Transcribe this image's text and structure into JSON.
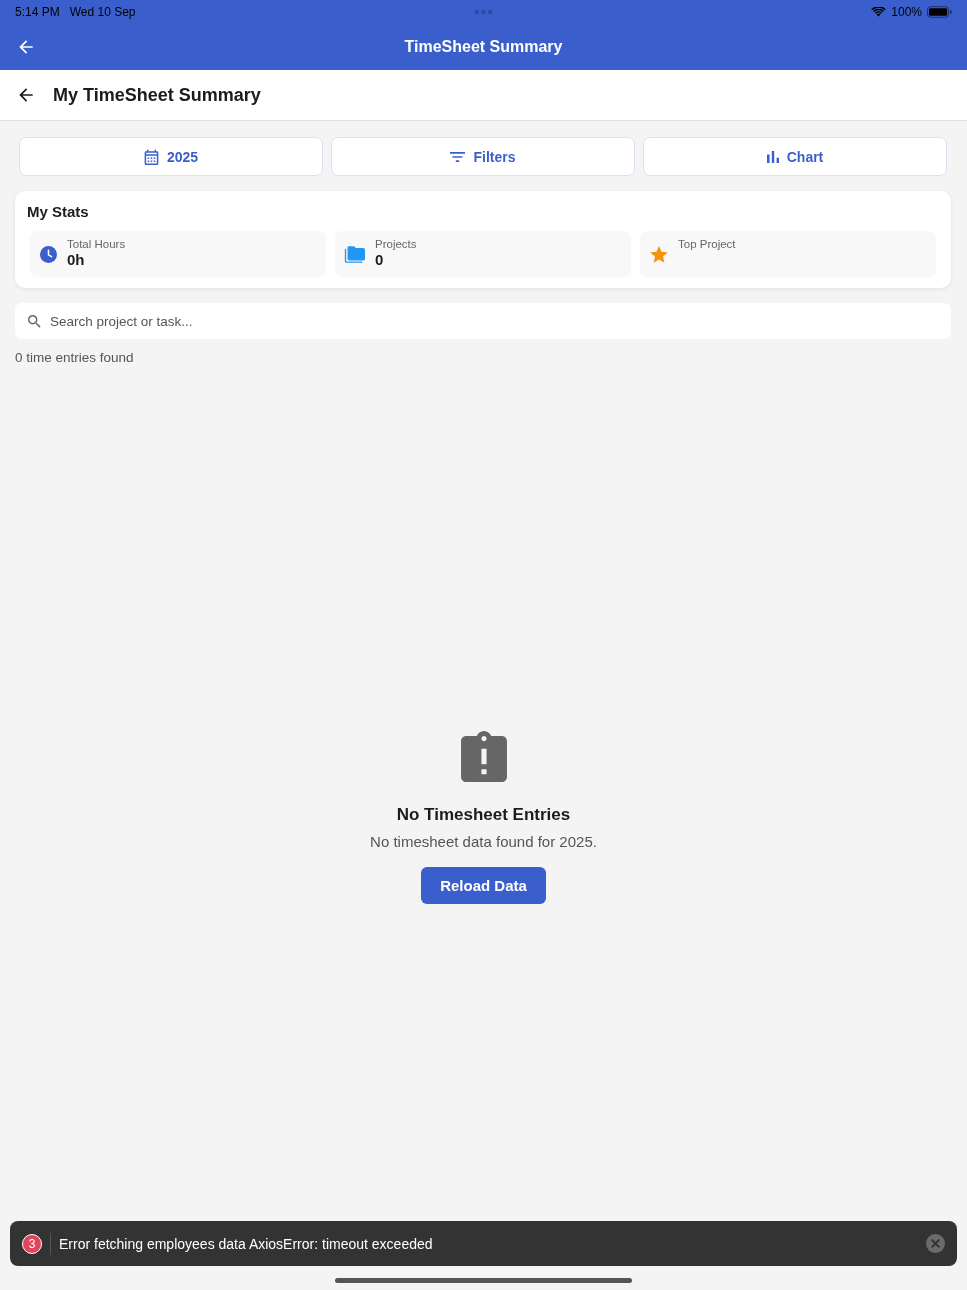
{
  "status_bar": {
    "time": "5:14 PM",
    "date": "Wed 10 Sep",
    "battery": "100%"
  },
  "app_bar": {
    "title": "TimeSheet Summary"
  },
  "page_header": {
    "title": "My TimeSheet Summary"
  },
  "toolbar": [
    {
      "kind": "calendar",
      "label": "2025"
    },
    {
      "kind": "filter",
      "label": "Filters"
    },
    {
      "kind": "chart",
      "label": "Chart"
    }
  ],
  "stats": {
    "title": "My Stats",
    "items": [
      {
        "kind": "clock",
        "label": "Total Hours",
        "value": "0h"
      },
      {
        "kind": "folder",
        "label": "Projects",
        "value": "0"
      },
      {
        "kind": "star",
        "label": "Top Project"
      }
    ]
  },
  "search": {
    "placeholder": "Search project or task..."
  },
  "result_count": "0 time entries found",
  "empty_state": {
    "title": "No Timesheet Entries",
    "message": "No timesheet data found for 2025.",
    "button": "Reload Data"
  },
  "toast": {
    "count": "3",
    "message": "Error fetching employees data AxiosError: timeout exceeded"
  }
}
